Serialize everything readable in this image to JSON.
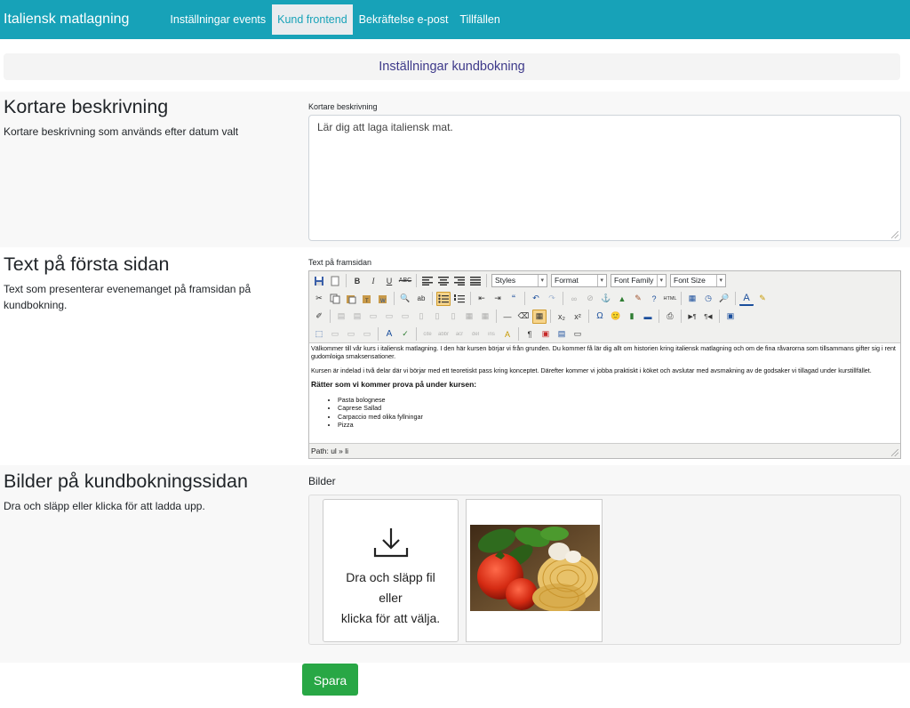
{
  "nav": {
    "brand": "Italiensk matlagning",
    "links": [
      "Inställningar events",
      "Kund frontend",
      "Bekräftelse e-post",
      "Tillfällen"
    ]
  },
  "page_title": "Inställningar kundbokning",
  "short_desc": {
    "title": "Kortare beskrivning",
    "help": "Kortare beskrivning som används efter datum valt",
    "label": "Kortare beskrivning",
    "value": "Lär dig att laga italiensk mat."
  },
  "front_text": {
    "title": "Text på första sidan",
    "help": "Text som presenterar evenemanget på framsidan på kundbokning.",
    "label": "Text på framsidan",
    "selects": [
      "Styles",
      "Format",
      "Font Family",
      "Font Size"
    ],
    "paragraphs": [
      "Välkommer till vår kurs i italiensk matlagning. I den här kursen börjar vi från grunden. Du kommer få lär dig allt om historien kring italiensk matlagning och om de fina råvarorna som tillsammans gifter sig i rent gudomloiga smaksensationer.",
      "Kursen är indelad i två delar där vi börjar med ett teoretiskt pass kring konceptet. Därefter kommer vi jobba praktiskt i köket och avslutar med avsmakning av de godsaker vi tillagad under kurstillfället."
    ],
    "heading": "Rätter som vi kommer prova på under kursen:",
    "list": [
      "Pasta bolognese",
      "Caprese Sallad",
      "Carpaccio med olika fyllningar",
      "Pizza"
    ],
    "path": "Path: ul » li"
  },
  "images": {
    "title": "Bilder på kundbokningssidan",
    "help": "Dra och släpp eller klicka för att ladda upp.",
    "label": "Bilder",
    "drop_line1": "Dra och släpp fil",
    "drop_line2": "eller",
    "drop_line3": "klicka för att välja."
  },
  "save_label": "Spara",
  "colors": {
    "navbar": "#17a2b8",
    "save": "#28a745",
    "title": "#3e3a8a"
  }
}
